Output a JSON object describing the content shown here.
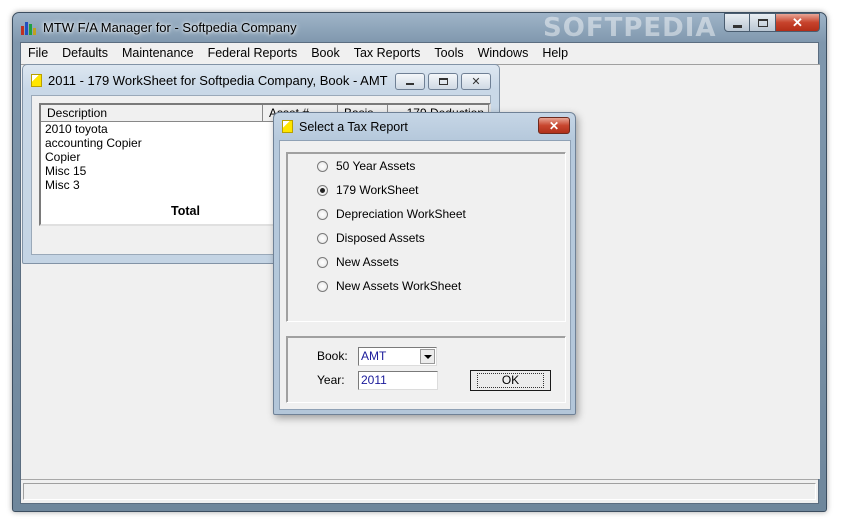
{
  "app": {
    "title": "MTW F/A Manager for - Softpedia Company",
    "watermark": "SOFTPEDIA"
  },
  "menu": [
    "File",
    "Defaults",
    "Maintenance",
    "Federal Reports",
    "Book",
    "Tax Reports",
    "Tools",
    "Windows",
    "Help"
  ],
  "worksheet": {
    "title": "2011 - 179 WorkSheet for Softpedia Company, Book - AMT",
    "columns": [
      "Description",
      "Asset #",
      "Basis",
      "179 Deduction"
    ],
    "rows": [
      "2010 toyota",
      "accounting Copier",
      "Copier",
      "Misc 15",
      "Misc 3"
    ],
    "total_label": "Total"
  },
  "dialog": {
    "title": "Select a Tax Report",
    "close_glyph": "✕",
    "options": [
      {
        "label": "50 Year Assets",
        "checked": false
      },
      {
        "label": "179 WorkSheet",
        "checked": true
      },
      {
        "label": "Depreciation WorkSheet",
        "checked": false
      },
      {
        "label": "Disposed Assets",
        "checked": false
      },
      {
        "label": "New Assets",
        "checked": false
      },
      {
        "label": "New Assets WorkSheet",
        "checked": false
      }
    ],
    "book_label": "Book:",
    "book_value": "AMT",
    "year_label": "Year:",
    "year_value": "2011",
    "ok_label": "OK"
  }
}
